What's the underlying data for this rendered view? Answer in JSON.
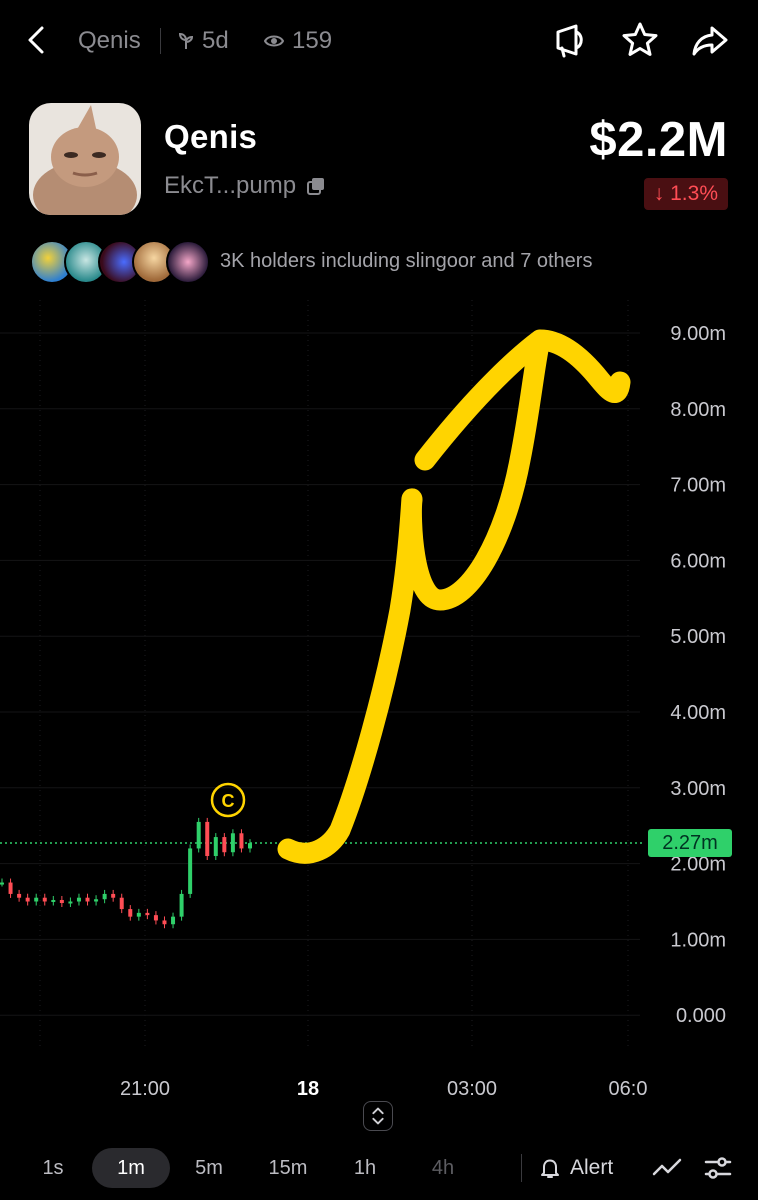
{
  "header": {
    "token_symbol": "Qenis",
    "age": "5d",
    "views": "159"
  },
  "token": {
    "name": "Qenis",
    "address": "EkcT...pump",
    "market_cap": "$2.2M",
    "change": "↓ 1.3%"
  },
  "holders": {
    "text": "3K holders including slingoor and 7 others"
  },
  "chart": {
    "current_price_label": "2.27m",
    "y_ticks": [
      "9.00m",
      "8.00m",
      "7.00m",
      "6.00m",
      "5.00m",
      "4.00m",
      "3.00m",
      "2.00m",
      "1.00m",
      "0.000"
    ],
    "x_ticks": [
      "21:00",
      "18",
      "03:00",
      "06:0"
    ],
    "marker_letter": "C"
  },
  "chart_data": {
    "type": "line",
    "title": "",
    "xlabel": "",
    "ylabel": "",
    "ylim": [
      0,
      9.5
    ],
    "y_unit": "m",
    "grid": true,
    "x_ticks": [
      "21:00",
      "18",
      "03:00",
      "06:0"
    ],
    "series": [
      {
        "values": [
          1.75,
          1.6,
          1.55,
          1.5,
          1.55,
          1.5,
          1.52,
          1.48,
          1.5,
          1.55,
          1.5,
          1.53,
          1.6,
          1.55,
          1.4,
          1.3,
          1.35,
          1.32,
          1.25,
          1.2,
          1.3,
          1.6,
          2.2,
          2.55,
          2.1,
          2.35,
          2.15,
          2.4,
          2.2,
          2.27
        ]
      }
    ],
    "current_value": 2.27
  },
  "timeframes": [
    "1s",
    "1m",
    "5m",
    "15m",
    "1h",
    "4h"
  ],
  "active_timeframe": "1m",
  "toolbar": {
    "alert_label": "Alert"
  },
  "colors": {
    "accent_green": "#2fd06a",
    "down_red": "#ff4d55",
    "annotation_yellow": "#ffd400"
  }
}
